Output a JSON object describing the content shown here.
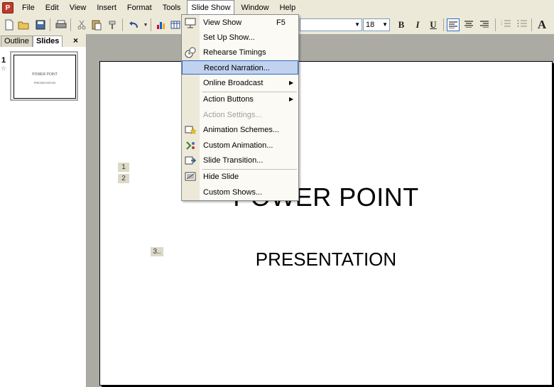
{
  "menubar": {
    "items": [
      "File",
      "Edit",
      "View",
      "Insert",
      "Format",
      "Tools",
      "Slide Show",
      "Window",
      "Help"
    ],
    "active": "Slide Show"
  },
  "toolbar": {
    "font_size": "18",
    "bold": "B",
    "italic": "I",
    "underline": "U",
    "grow_font": "A"
  },
  "left_panel": {
    "tab_outline": "Outline",
    "tab_slides": "Slides",
    "close": "×",
    "slide_number": "1",
    "thumb_title": "POWER POINT",
    "thumb_subtitle": "PRESENTATION"
  },
  "slide": {
    "title": "POWER POINT",
    "subtitle": "PRESENTATION",
    "anim_tags": [
      "1",
      "2",
      "3.."
    ]
  },
  "dropdown": {
    "items": [
      {
        "label": "View Show",
        "shortcut": "F5",
        "icon": "projector-icon"
      },
      {
        "label": "Set Up Show...",
        "icon": ""
      },
      {
        "label": "Rehearse Timings",
        "icon": "timings-icon"
      },
      {
        "label": "Record Narration...",
        "icon": "",
        "highlighted": true
      },
      {
        "label": "Online Broadcast",
        "submenu": true
      },
      {
        "label": "Action Buttons",
        "submenu": true
      },
      {
        "label": "Action Settings...",
        "disabled": true
      },
      {
        "label": "Animation Schemes...",
        "icon": "animation-schemes-icon"
      },
      {
        "label": "Custom Animation...",
        "icon": "custom-animation-icon"
      },
      {
        "label": "Slide Transition...",
        "icon": "slide-transition-icon"
      },
      {
        "label": "Hide Slide",
        "icon": "hide-slide-icon"
      },
      {
        "label": "Custom Shows...",
        "icon": ""
      }
    ]
  },
  "colors": {
    "chrome": "#ece9d8",
    "workspace": "#ababa3",
    "highlight": "#c1d2ee",
    "highlight_border": "#316ac5"
  }
}
